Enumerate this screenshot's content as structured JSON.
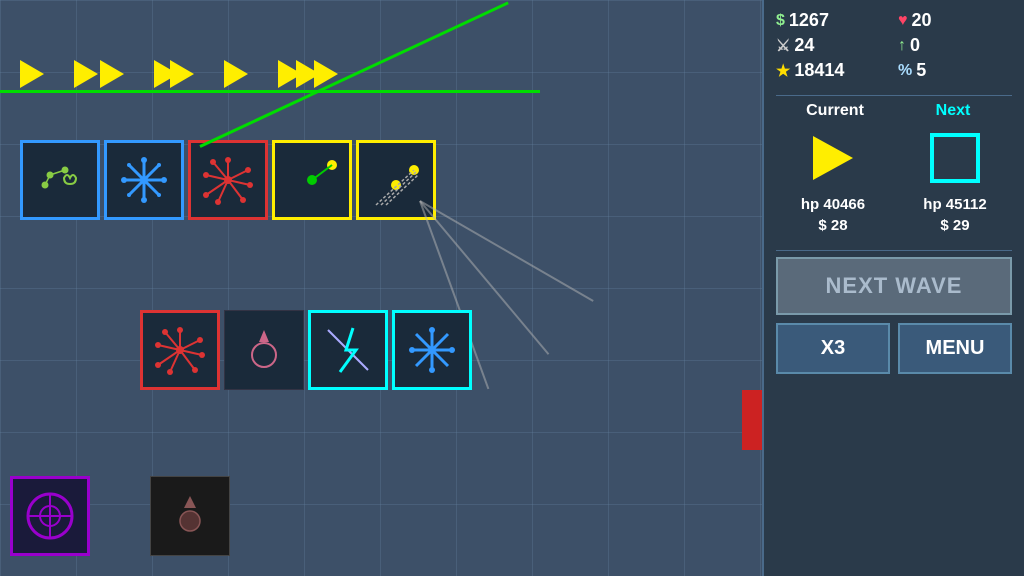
{
  "stats": {
    "money": "1267",
    "health": "20",
    "sword": "24",
    "arrow_up": "0",
    "star": "18414",
    "percent": "5",
    "money_symbol": "$",
    "heart_symbol": "♥",
    "sword_symbol": "🗡",
    "arrow_symbol": "↑",
    "star_symbol": "★",
    "percent_symbol": "%"
  },
  "wave": {
    "current_label": "Current",
    "next_label": "Next",
    "current_hp": "hp 40466",
    "next_hp": "hp 45112",
    "current_cost": "$ 28",
    "next_cost": "$ 29"
  },
  "buttons": {
    "next_wave": "NEXT WAVE",
    "x3": "X3",
    "menu": "MENU"
  }
}
